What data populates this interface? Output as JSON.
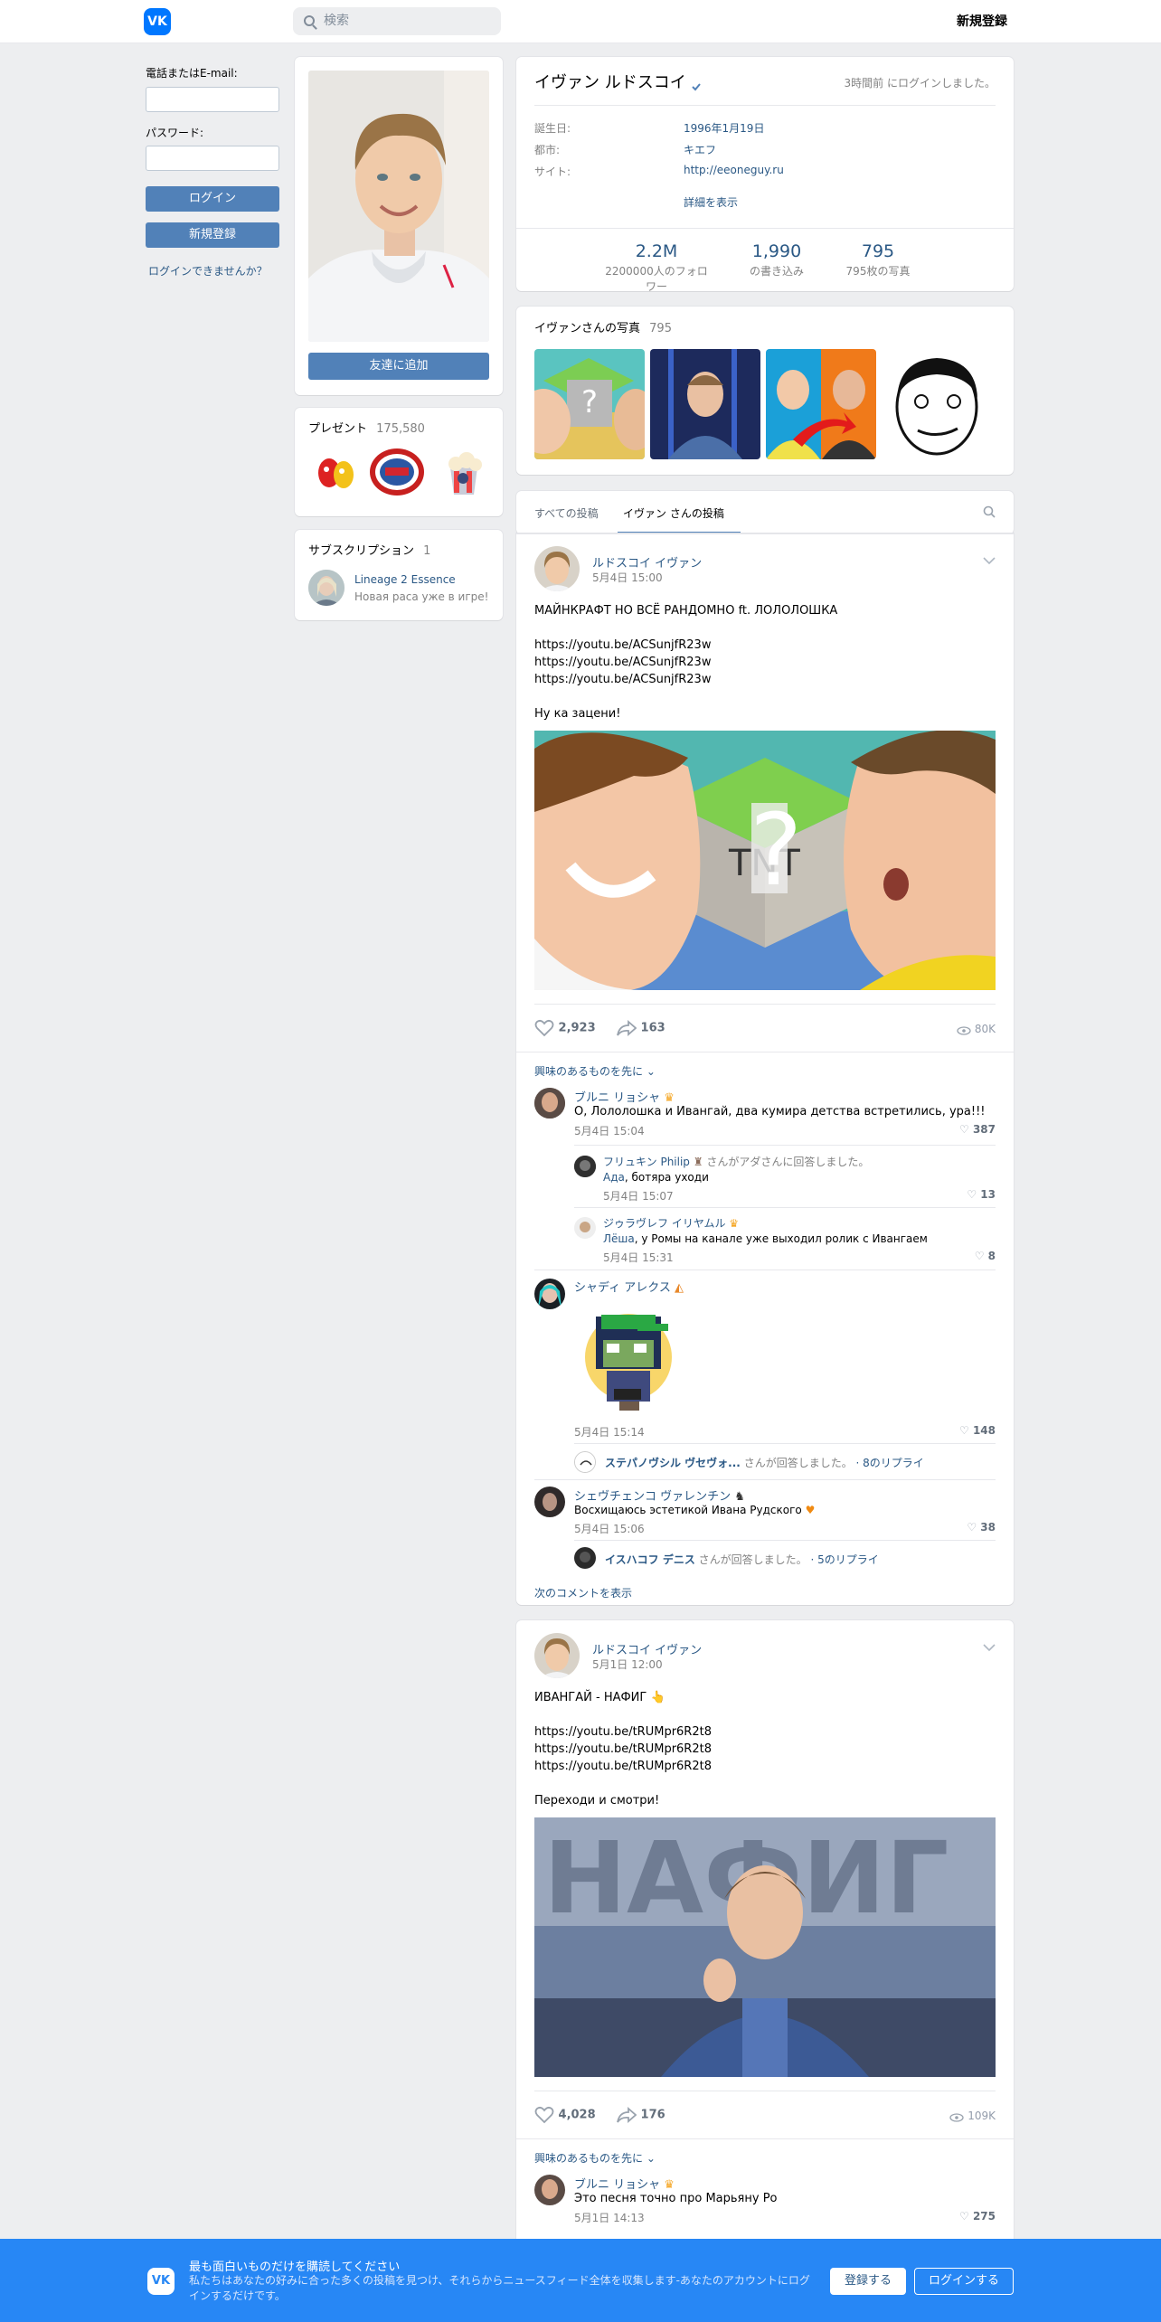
{
  "header": {
    "logo": "VK",
    "search_placeholder": "検索",
    "signup": "新規登録"
  },
  "login": {
    "phone_label": "電話またはE-mail:",
    "password_label": "パスワード:",
    "login_button": "ログイン",
    "register_button": "新規登録",
    "forgot": "ログインできませんか？"
  },
  "profile": {
    "add_friend": "友達に追加",
    "name": "イヴァン ルドスコイ",
    "last_seen": "3時間前 にログインしました。",
    "rows": [
      {
        "k": "誕生日:",
        "v": "1996年1月19日"
      },
      {
        "k": "都市:",
        "v": "キエフ"
      },
      {
        "k": "サイト:",
        "v": "http://eeoneguy.ru"
      }
    ],
    "more": "詳細を表示",
    "stats": [
      {
        "n": "2.2M",
        "t": "2200000人のフォロワー"
      },
      {
        "n": "1,990",
        "t": "の書き込み"
      },
      {
        "n": "795",
        "t": "795枚の写真"
      }
    ]
  },
  "gifts": {
    "title": "プレゼント",
    "count": "175,580"
  },
  "subscriptions": {
    "title": "サブスクリプション",
    "count": "1",
    "item_name": "Lineage 2 Essence",
    "item_desc": "Новая раса уже в игре!"
  },
  "photos": {
    "title": "イヴァンさんの写真",
    "count": "795"
  },
  "wall_tabs": {
    "all": "すべての投稿",
    "own": "イヴァン さんの投稿"
  },
  "post1": {
    "author": "ルドスコイ イヴァン",
    "date": "5月4日 15:00",
    "title": "МАЙНКРАФТ НО ВСЁ РАНДОМНО ft. ЛОЛОЛОШКА",
    "links": [
      "https://youtu.be/ACSunjfR23w",
      "https://youtu.be/ACSunjfR23w",
      "https://youtu.be/ACSunjfR23w"
    ],
    "cta": "Ну ка зацени!",
    "likes": "2,923",
    "shares": "163",
    "views": "80K",
    "interesting_first": "興味のあるものを先に",
    "comments": [
      {
        "name": "ブルニ リョシャ",
        "text": "О, Лололошка и Ивангай, два кумира детства встретились, ура!!!",
        "date": "5月4日 15:04",
        "likes": "387"
      },
      {
        "name": "フリュキン Philip",
        "reply": "さんがアダさんに回答しました。",
        "to": "Ада",
        "text": ", ботяра уходи",
        "date": "5月4日 15:07",
        "likes": "13"
      },
      {
        "name": "ジゥラヴレフ イリヤムル",
        "to": "Лёша",
        "text": ", у Ромы на канале уже выходил ролик с Ивангаем",
        "date": "5月4日 15:31",
        "likes": "8"
      },
      {
        "name": "シャディ アレクス",
        "date": "5月4日 15:14",
        "likes": "148"
      },
      {
        "name": "ステパノヴシル ヴセヴォ...",
        "reply": "さんが回答しました。",
        "replies": "· 8のリプライ"
      },
      {
        "name": "シェヴチェンコ ヴァレンチン",
        "text": "Восхищаюсь эстетикой Ивана Рудского",
        "date": "5月4日 15:06",
        "likes": "38"
      },
      {
        "name": "イスハコフ デニス",
        "reply": "さんが回答しました。",
        "replies": "· 5のリプライ"
      }
    ],
    "next_comments": "次のコメントを表示"
  },
  "post2": {
    "author": "ルドスコイ イヴァン",
    "date": "5月1日 12:00",
    "title": "ИВАНГАЙ - НАФИГ 👆",
    "links": [
      "https://youtu.be/tRUMpr6R2t8",
      "https://youtu.be/tRUMpr6R2t8",
      "https://youtu.be/tRUMpr6R2t8"
    ],
    "cta": "Переходи и смотри!",
    "likes": "4,028",
    "shares": "176",
    "views": "109K",
    "interesting_first": "興味のあるものを先に",
    "comment": {
      "name": "ブルニ リョシャ",
      "text": "Это песня точно про Марьяну Ро",
      "date": "5月1日 14:13",
      "likes": "275"
    }
  },
  "banner": {
    "title": "最も面白いものだけを購読してください",
    "text": "私たちはあなたの好みに合った多くの投稿を見つけ、それらからニュースフィード全体を収集します-あなたのアカウントにログインするだけです。",
    "register": "登録する",
    "login": "ログインする"
  },
  "colors": {
    "accent": "#2a5885",
    "button": "#5181b8",
    "banner": "#2787f5"
  }
}
